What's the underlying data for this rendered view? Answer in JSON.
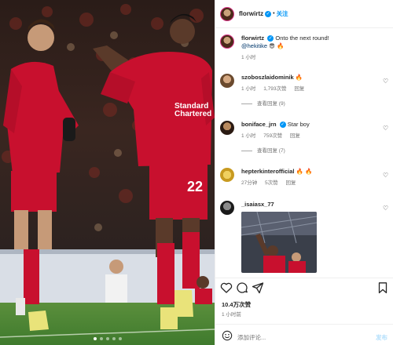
{
  "post": {
    "author": "florwirtz",
    "follow_label": "关注",
    "separator": "•",
    "caption_text": "Onto the next round!",
    "caption_mention": "@hekitike",
    "caption_emoji": "😎 🔥",
    "caption_time": "1 小时",
    "media": {
      "slide_count": 5,
      "active_slide": 1
    }
  },
  "comments": [
    {
      "username": "szoboszlaidominik",
      "text": "🔥",
      "time": "1 小时",
      "likes": "1,793次赞",
      "reply_label": "回复",
      "view_replies": "查看回复 (9)"
    },
    {
      "username": "boniface_jrn",
      "verified": true,
      "text": "Star boy",
      "time": "1 小时",
      "likes": "759次赞",
      "reply_label": "回复",
      "view_replies": "查看回复 (7)"
    },
    {
      "username": "hepterkinterofficial",
      "text": "🔥 🔥",
      "time": "27分钟",
      "likes": "5次赞",
      "reply_label": "回复"
    },
    {
      "username": "_isaiasx_77",
      "text": ""
    }
  ],
  "actions": {
    "likes_count": "10.4万次赞",
    "time": "1 小时前",
    "add_comment_placeholder": "添加评论...",
    "post_label": "发布",
    "icons": [
      "heart-icon",
      "comment-icon",
      "share-icon",
      "bookmark-icon",
      "emoji-icon"
    ]
  },
  "colors": {
    "accent_blue": "#0095f6",
    "liverpool_red": "#c8102e",
    "meta_grey": "#737373"
  }
}
